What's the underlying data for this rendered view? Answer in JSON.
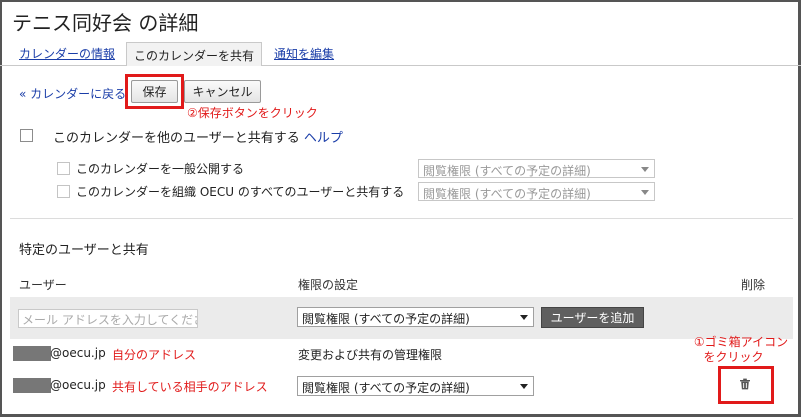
{
  "page": {
    "title": "テニス同好会 の詳細"
  },
  "tabs": [
    {
      "label": "カレンダーの情報",
      "active": false
    },
    {
      "label": "このカレンダーを共有",
      "active": true
    },
    {
      "label": "通知を編集",
      "active": false
    }
  ],
  "toolbar": {
    "back_label": "« カレンダーに戻る",
    "save_label": "保存",
    "cancel_label": "キャンセル"
  },
  "annotations": {
    "save_note": "②保存ボタンをクリック",
    "trash_note_line1": "①ゴミ箱アイコン",
    "trash_note_line2": "をクリック",
    "self_note": "自分のアドレス",
    "shared_note": "共有している相手のアドレス"
  },
  "share_public": {
    "label": "このカレンダーを他のユーザーと共有する",
    "help_label": "ヘルプ",
    "publish_label": "このカレンダーを一般公開する",
    "publish_permission": "閲覧権限 (すべての予定の詳細)",
    "org_label": "このカレンダーを組織 OECU のすべてのユーザーと共有する",
    "org_permission": "閲覧権限 (すべての予定の詳細)"
  },
  "specific_users": {
    "heading": "特定のユーザーと共有",
    "col_user": "ユーザー",
    "col_permission": "権限の設定",
    "col_delete": "削除",
    "email_placeholder": "メール アドレスを入力してください",
    "new_permission": "閲覧権限 (すべての予定の詳細)",
    "add_button": "ユーザーを追加",
    "rows": [
      {
        "email_domain": "@oecu.jp",
        "permission": "変更および共有の管理権限"
      },
      {
        "email_domain": "@oecu.jp",
        "permission": "閲覧権限 (すべての予定の詳細)"
      }
    ]
  },
  "icons": {
    "delete": "trash-icon"
  },
  "colors": {
    "annotation": "#e11a1a",
    "link": "#1a3da8",
    "add_button": "#5f5f5f"
  }
}
